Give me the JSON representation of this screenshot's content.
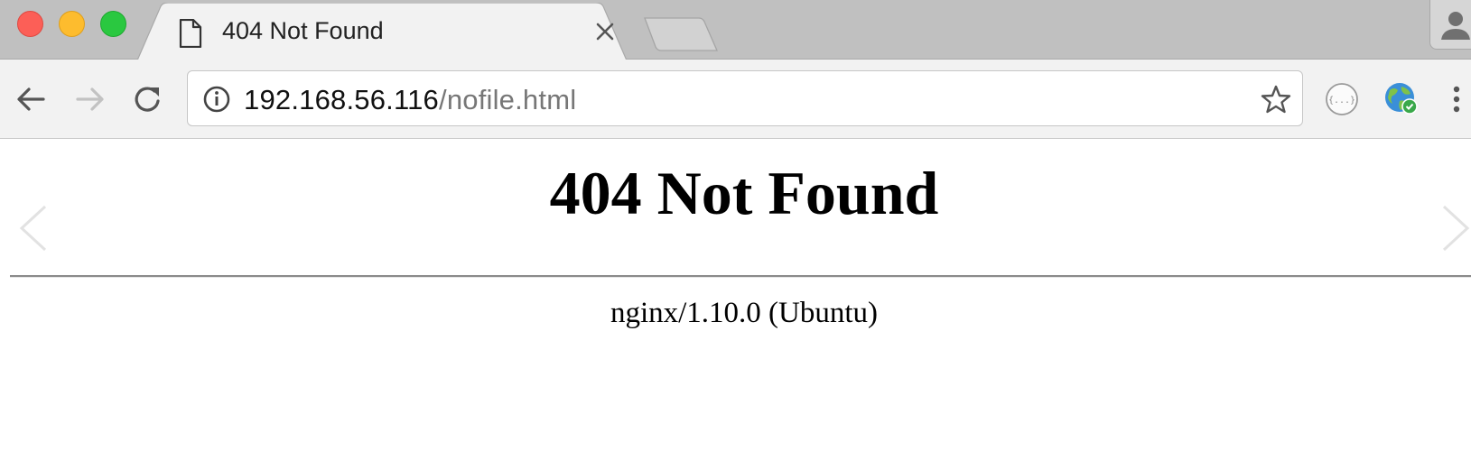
{
  "window": {
    "traffic_lights": [
      "close",
      "minimize",
      "zoom"
    ]
  },
  "tab": {
    "title": "404 Not Found",
    "icon": "document-icon",
    "close_icon": "close-icon"
  },
  "toolbar": {
    "url_host": "192.168.56.116",
    "url_path": "/nofile.html",
    "icons": [
      "back-arrow-icon",
      "forward-arrow-icon",
      "reload-icon",
      "info-icon",
      "star-icon",
      "json-extension-icon",
      "globe-extension-icon",
      "menu-icon"
    ]
  },
  "page": {
    "heading": "404 Not Found",
    "server_signature": "nginx/1.10.0 (Ubuntu)"
  },
  "colors": {
    "tabstrip": "#c0c0c0",
    "toolbar": "#f2f2f2",
    "close": "#fc5f57",
    "minimize": "#fdbc2e",
    "zoom": "#2ac840"
  }
}
